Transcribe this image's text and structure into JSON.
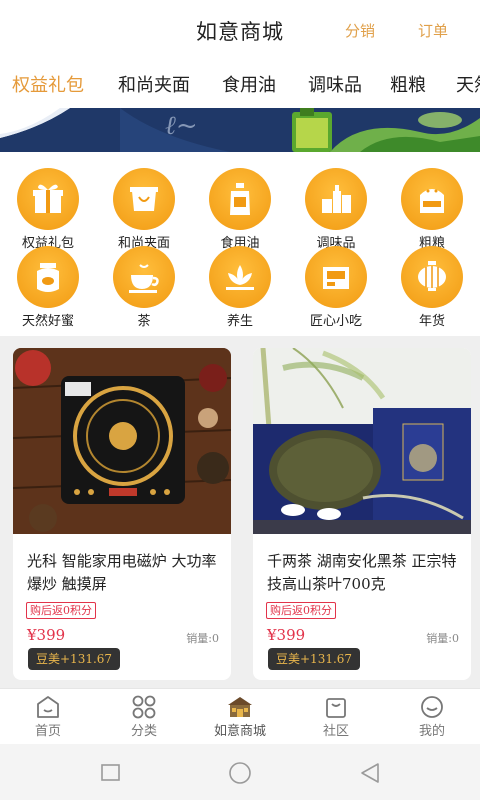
{
  "header": {
    "title": "如意商城",
    "link_distribution": "分销",
    "link_orders": "订单"
  },
  "category_tabs": [
    "权益礼包",
    "和尚夹面",
    "食用油",
    "调味品",
    "粗粮",
    "天然"
  ],
  "active_tab_index": 0,
  "grid": {
    "row1": [
      "权益礼包",
      "和尚夹面",
      "食用油",
      "调味品",
      "粗粮"
    ],
    "row2": [
      "天然好蜜",
      "茶",
      "养生",
      "匠心小吃",
      "年货"
    ]
  },
  "grid_icons": {
    "row1": [
      "gift-icon",
      "noodle-bowl-icon",
      "oil-bottle-icon",
      "condiment-icon",
      "grain-bag-icon"
    ],
    "row2": [
      "honey-jar-icon",
      "tea-cup-icon",
      "lotus-icon",
      "snack-box-icon",
      "lantern-icon"
    ]
  },
  "products": [
    {
      "name": "光科 智能家用电磁炉 大功率爆炒 触摸屏",
      "tag": "购后返0积分",
      "price": "¥399",
      "sales": "销量:0",
      "beans": "豆美+131.67"
    },
    {
      "name": "千两茶 湖南安化黑茶 正宗特技高山茶叶700克",
      "tag": "购后返0积分",
      "price": "¥399",
      "sales": "销量:0",
      "beans": "豆美+131.67"
    }
  ],
  "tabbar": {
    "items": [
      "首页",
      "分类",
      "如意商城",
      "社区",
      "我的"
    ],
    "active_index": 2
  },
  "colors": {
    "accent": "#e59a3a",
    "price": "#e2334a",
    "icon_circle": "#f5a623"
  }
}
